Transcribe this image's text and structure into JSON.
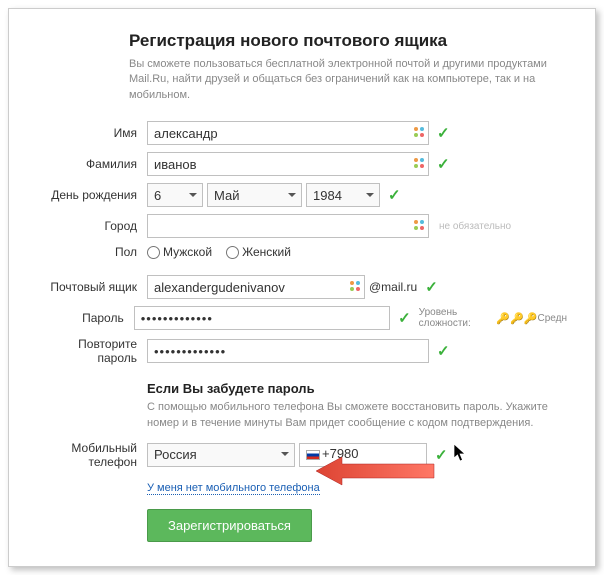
{
  "header": {
    "title": "Регистрация нового почтового ящика",
    "subtitle": "Вы сможете пользоваться бесплатной электронной почтой и другими продуктами Mail.Ru, найти друзей и общаться без ограничений как на компьютере, так и на мобильном."
  },
  "labels": {
    "firstname": "Имя",
    "lastname": "Фамилия",
    "birthday": "День рождения",
    "city": "Город",
    "gender": "Пол",
    "mailbox": "Почтовый ящик",
    "password": "Пароль",
    "repeat_password": "Повторите пароль",
    "mobile": "Мобильный телефон",
    "optional": "не обязательно",
    "strength_label": "Уровень сложности:",
    "strength_value": "Средн"
  },
  "fields": {
    "firstname": "александр",
    "lastname": "иванов",
    "birthday": {
      "day": "6",
      "month": "Май",
      "year": "1984"
    },
    "city": "",
    "gender": {
      "male": "Мужской",
      "female": "Женский"
    },
    "mailbox": "alexandergudenivanov",
    "domain": "@mail.ru",
    "password": "•••••••••••••",
    "password2": "•••••••••••••",
    "phone": {
      "country": "Россия",
      "prefix": "+7980"
    }
  },
  "recovery": {
    "title": "Если Вы забудете пароль",
    "desc": "С помощью мобильного телефона Вы сможете восстановить пароль. Укажите номер и в течение минуты Вам придет сообщение с кодом подтверждения.",
    "no_phone_link": "У меня нет мобильного телефона"
  },
  "buttons": {
    "submit": "Зарегистрироваться"
  }
}
